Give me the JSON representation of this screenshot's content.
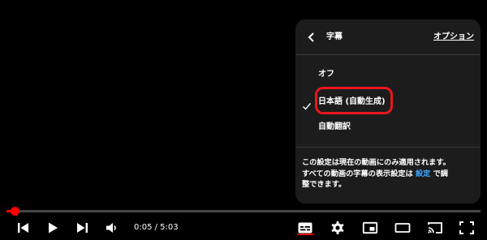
{
  "settings_panel": {
    "title": "字幕",
    "options_link": "オプション",
    "items": [
      {
        "label": "オフ",
        "selected": false
      },
      {
        "label": "日本語 (自動生成)",
        "selected": true
      },
      {
        "label": "自動翻訳",
        "selected": false
      }
    ],
    "notice_text": "この設定は現在の動画にのみ適用されます。\nすべての動画の字幕の表示設定は ",
    "notice_link": "設定",
    "notice_text_after": " で調\n整できます。"
  },
  "player": {
    "current_time": "0:05",
    "separator": " / ",
    "duration": "5:03",
    "time_display": "0:05 / 5:03",
    "progress_fraction": 0.0165,
    "accent_color": "#ff0000",
    "link_color": "#3ea6ff"
  },
  "icons": {
    "previous": "skip-previous-icon",
    "play": "play-icon",
    "next": "skip-next-icon",
    "volume": "volume-icon",
    "captions": "captions-icon",
    "settings": "gear-icon",
    "miniplayer": "miniplayer-icon",
    "theater": "theater-mode-icon",
    "cast": "cast-icon",
    "fullscreen": "fullscreen-icon"
  }
}
